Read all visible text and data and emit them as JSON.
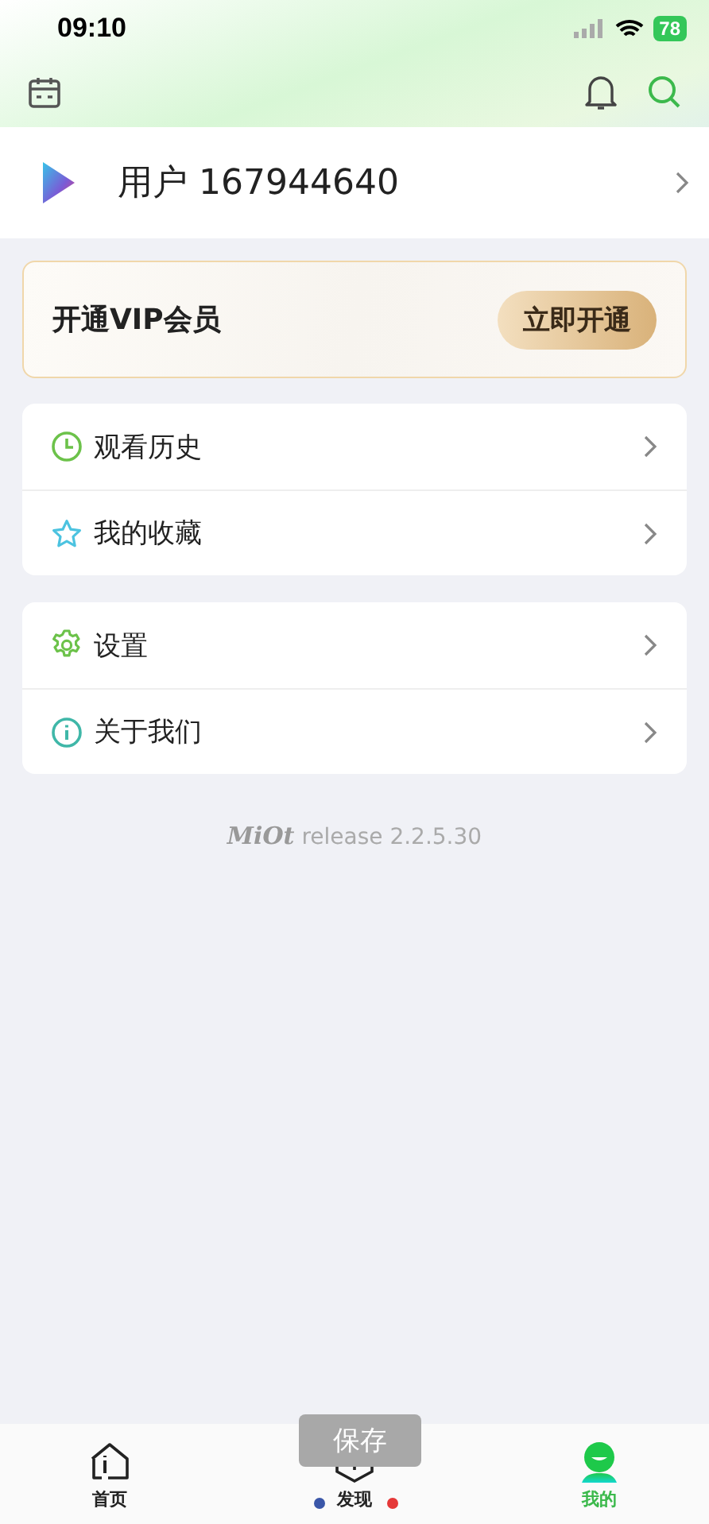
{
  "status_bar": {
    "time": "09:10",
    "battery": "78"
  },
  "user": {
    "name": "用户 167944640"
  },
  "vip": {
    "title": "开通VIP会员",
    "button": "立即开通"
  },
  "menu_groups": [
    {
      "items": [
        {
          "kind": "history",
          "label": "观看历史"
        },
        {
          "kind": "favorites",
          "label": "我的收藏"
        }
      ]
    },
    {
      "items": [
        {
          "kind": "settings",
          "label": "设置"
        },
        {
          "kind": "about",
          "label": "关于我们"
        }
      ]
    }
  ],
  "version": {
    "logo": "MiOt",
    "text": "release 2.2.5.30"
  },
  "toast": "保存",
  "tabs": [
    {
      "kind": "home",
      "label": "首页",
      "selected": false
    },
    {
      "kind": "discover",
      "label": "发现",
      "selected": false
    },
    {
      "kind": "me",
      "label": "我的",
      "selected": true
    }
  ]
}
